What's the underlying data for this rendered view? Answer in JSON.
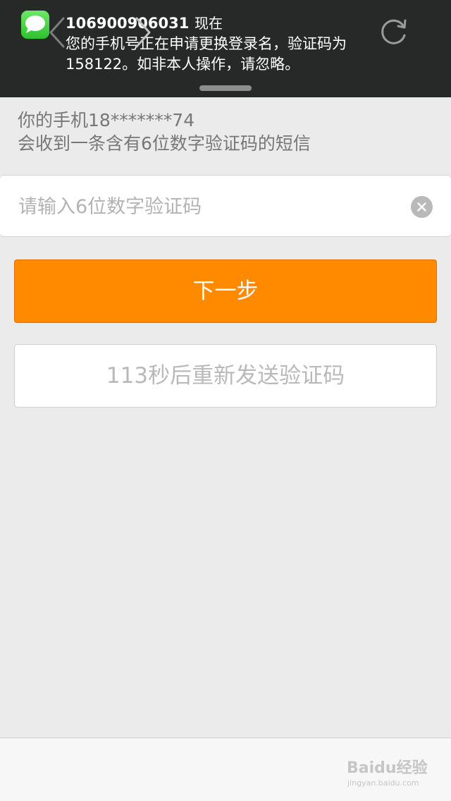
{
  "notification": {
    "app_icon": "messages-icon",
    "sender": "106900906031",
    "time": "现在",
    "line1": "您的手机号正在申请更换登录名，验证码为",
    "line2": "158122。如非本人操作，请忽略。"
  },
  "hint": {
    "line1": "你的手机18*******74",
    "line2": "会收到一条含有6位数字验证码的短信"
  },
  "code_input": {
    "value": "",
    "placeholder": "请输入6位数字验证码"
  },
  "next_button": {
    "label": "下一步"
  },
  "resend_button": {
    "label": "113秒后重新发送验证码"
  },
  "toolbar": {
    "back_icon": "chevron-left-icon",
    "forward_icon": "chevron-right-icon",
    "refresh_icon": "refresh-icon"
  },
  "watermark": {
    "text": "Baidu经验",
    "sub": "jingyan.baidu.com"
  },
  "colors": {
    "accent": "#ff8a00",
    "notification_bg": "#272828",
    "page_bg": "#ebebeb",
    "messages_green": "#2cc22b"
  }
}
